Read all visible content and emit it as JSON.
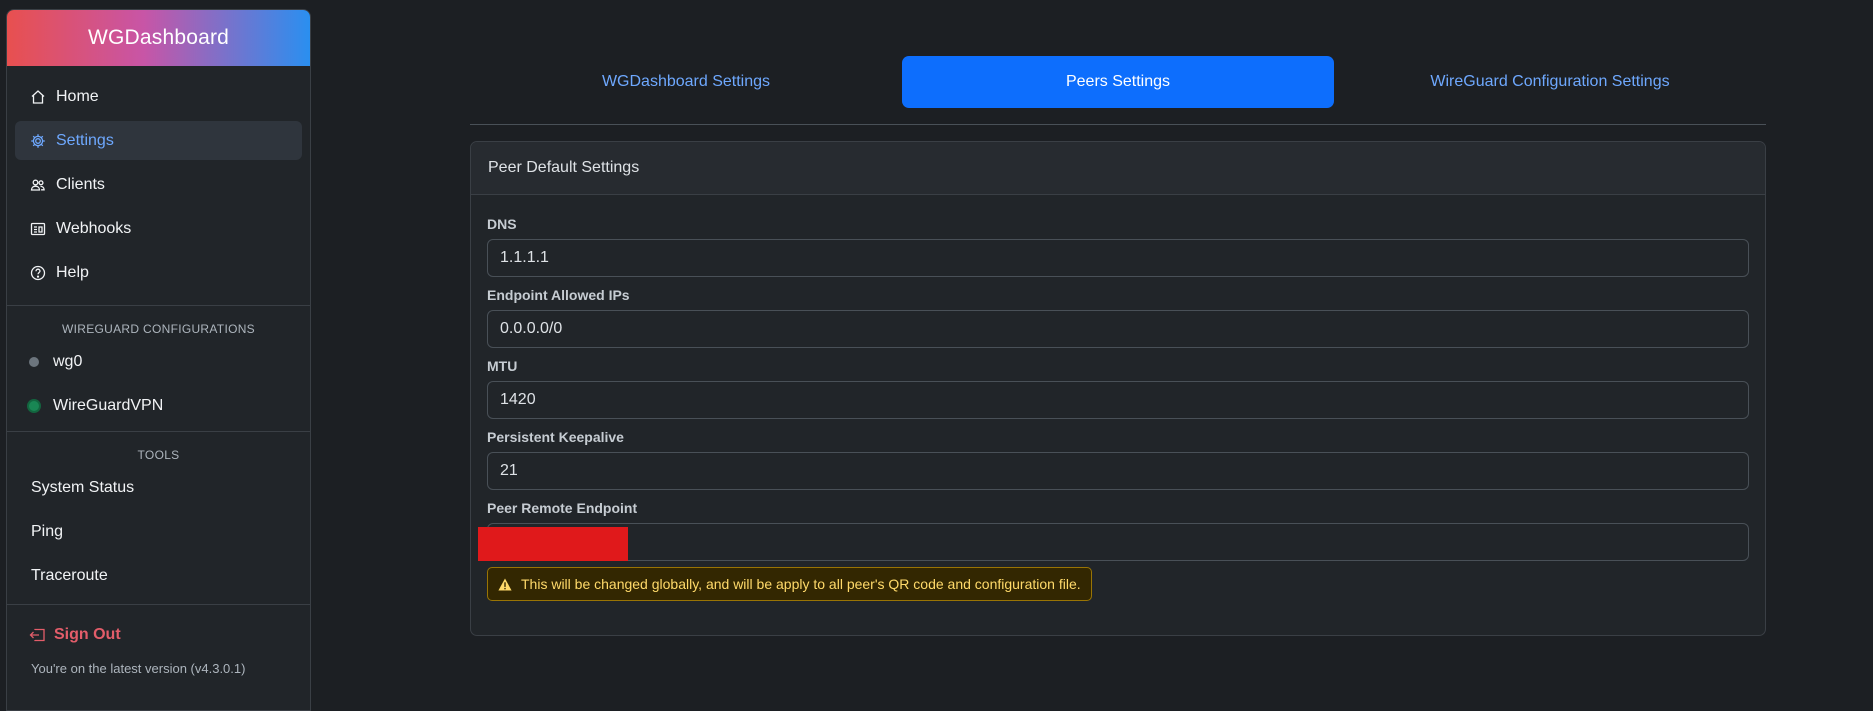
{
  "app": {
    "brand": "WGDashboard"
  },
  "sidebar": {
    "nav": [
      {
        "label": "Home",
        "icon": "house-icon"
      },
      {
        "label": "Settings",
        "icon": "gear-icon",
        "active": true
      },
      {
        "label": "Clients",
        "icon": "people-icon"
      },
      {
        "label": "Webhooks",
        "icon": "webhook-icon"
      },
      {
        "label": "Help",
        "icon": "question-circle-icon"
      }
    ],
    "configs_title": "WIREGUARD CONFIGURATIONS",
    "configs": [
      {
        "label": "wg0",
        "status": "inactive",
        "color": "#6c757d"
      },
      {
        "label": "WireGuardVPN",
        "status": "active",
        "color": "#198754"
      }
    ],
    "tools_title": "TOOLS",
    "tools": [
      {
        "label": "System Status"
      },
      {
        "label": "Ping"
      },
      {
        "label": "Traceroute"
      }
    ],
    "signout_label": "Sign Out",
    "version_text": "You're on the latest version (v4.3.0.1)"
  },
  "tabs": [
    {
      "label": "WGDashboard Settings",
      "active": false
    },
    {
      "label": "Peers Settings",
      "active": true
    },
    {
      "label": "WireGuard Configuration Settings",
      "active": false
    }
  ],
  "card": {
    "title": "Peer Default Settings",
    "fields": [
      {
        "label": "DNS",
        "value": "1.1.1.1"
      },
      {
        "label": "Endpoint Allowed IPs",
        "value": "0.0.0.0/0"
      },
      {
        "label": "MTU",
        "value": "1420"
      },
      {
        "label": "Persistent Keepalive",
        "value": "21"
      },
      {
        "label": "Peer Remote Endpoint",
        "value": "",
        "redacted": true
      }
    ],
    "warning": "This will be changed globally, and will be apply to all peer's QR code and configuration file."
  },
  "colors": {
    "accent": "#0d6efd",
    "link": "#6ea8fe",
    "danger": "#e35d6a",
    "warning_text": "#ffda6a"
  }
}
